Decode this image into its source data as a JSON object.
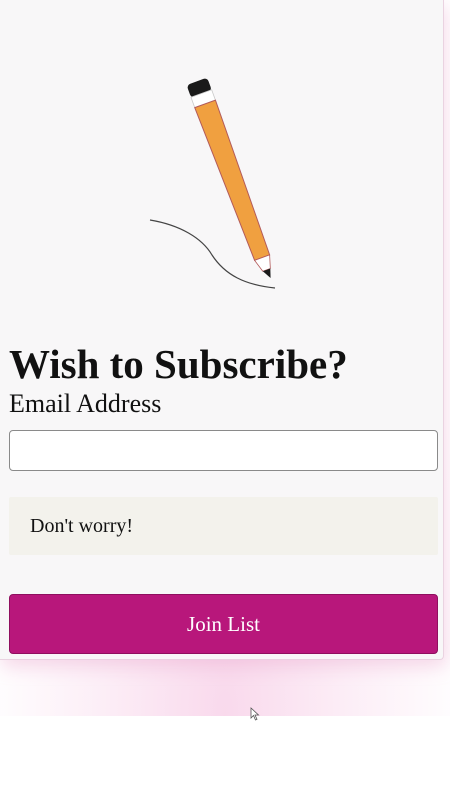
{
  "form": {
    "title": "Wish to Subscribe?",
    "email_label": "Email Address",
    "email_value": "",
    "email_placeholder": "",
    "note": "Don't worry!",
    "submit_label": "Join List"
  },
  "illustration": {
    "icon": "pencil-drawing-icon"
  },
  "colors": {
    "accent": "#b8177b",
    "card_background": "#f8f7f8",
    "note_background": "#f3f2ec",
    "pencil_body": "#f0a040"
  }
}
